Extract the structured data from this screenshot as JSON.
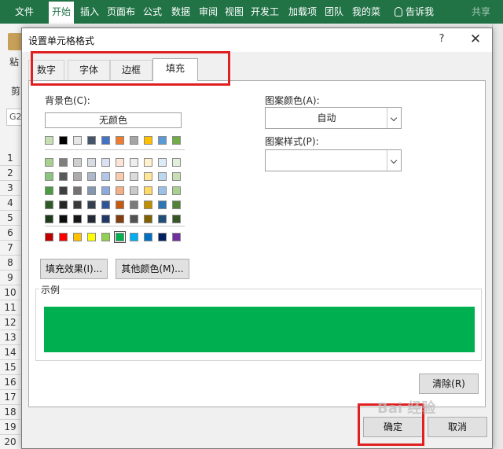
{
  "ribbon": {
    "bg": "#217346",
    "tabs": [
      {
        "label": "文件",
        "active": false
      },
      {
        "label": "开始",
        "active": true
      },
      {
        "label": "插入",
        "active": false
      },
      {
        "label": "页面布",
        "active": false
      },
      {
        "label": "公式",
        "active": false
      },
      {
        "label": "数据",
        "active": false
      },
      {
        "label": "审阅",
        "active": false
      },
      {
        "label": "视图",
        "active": false
      },
      {
        "label": "开发工",
        "active": false
      },
      {
        "label": "加载项",
        "active": false
      },
      {
        "label": "团队",
        "active": false
      },
      {
        "label": "我的菜",
        "active": false
      }
    ],
    "tell_me": "告诉我",
    "share": "共享"
  },
  "sheet": {
    "paste_label": "粘",
    "clip_label": "剪",
    "name_box": "G2",
    "rows": [
      "1",
      "2",
      "3",
      "4",
      "5",
      "6",
      "7",
      "8",
      "9",
      "10",
      "11",
      "12",
      "13",
      "14",
      "15",
      "16",
      "17",
      "18",
      "19",
      "20"
    ]
  },
  "dialog": {
    "title": "设置单元格格式",
    "help": "?",
    "close": "✕",
    "tabs": [
      {
        "label": "数字",
        "active": false
      },
      {
        "label": "字体",
        "active": false
      },
      {
        "label": "边框",
        "active": false
      },
      {
        "label": "填充",
        "active": true
      }
    ],
    "fill": {
      "background_label": "背景色(C):",
      "no_color": "无颜色",
      "theme_colors": [
        [
          "#c6e0b4",
          "#000000",
          "#e7e6e6",
          "#44546a",
          "#4472c4",
          "#ed7d31",
          "#a5a5a5",
          "#ffc000",
          "#5b9bd5",
          "#70ad47"
        ],
        [
          "#a9d08e",
          "#7f7f7f",
          "#d0cece",
          "#d6dce4",
          "#d9e1f2",
          "#fce4d6",
          "#ededed",
          "#fff2cc",
          "#ddebf7",
          "#e2efda"
        ],
        [
          "#8bc57f",
          "#595959",
          "#aeaaaa",
          "#acb9ca",
          "#b4c6e7",
          "#f8cbad",
          "#dbdbdb",
          "#ffe699",
          "#bdd7ee",
          "#c6e0b4"
        ],
        [
          "#4d9a44",
          "#3f3f3f",
          "#757171",
          "#8497b0",
          "#8ea9db",
          "#f4b084",
          "#c9c9c9",
          "#ffd966",
          "#9bc2e6",
          "#a9d08e"
        ],
        [
          "#2e5a2a",
          "#262626",
          "#3a3838",
          "#333f4f",
          "#2f5597",
          "#c65911",
          "#7b7b7b",
          "#bf8f00",
          "#2e75b6",
          "#548235"
        ],
        [
          "#1f3b1c",
          "#0d0d0d",
          "#161616",
          "#222b35",
          "#203864",
          "#833c0c",
          "#525252",
          "#806000",
          "#1f4e78",
          "#375623"
        ]
      ],
      "standard_colors": [
        "#c00000",
        "#ff0000",
        "#ffc000",
        "#ffff00",
        "#92d050",
        "#00b050",
        "#00b0f0",
        "#0070c0",
        "#002060",
        "#7030a0"
      ],
      "selected_standard_index": 5,
      "fill_effects_button": "填充效果(I)...",
      "more_colors_button": "其他颜色(M)...",
      "pattern_color_label": "图案颜色(A):",
      "pattern_color_value": "自动",
      "pattern_style_label": "图案样式(P):",
      "pattern_style_value": "",
      "sample_label": "示例",
      "sample_color": "#00b050",
      "clear_button": "清除(R)"
    },
    "ok_button": "确定",
    "cancel_button": "取消"
  },
  "highlight_color": "#e02020",
  "watermark": "Bai 经验"
}
